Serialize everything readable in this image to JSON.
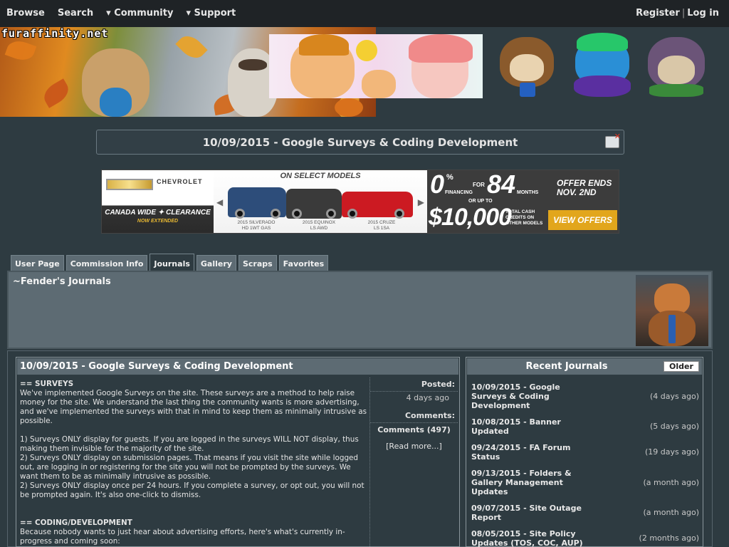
{
  "nav": {
    "left": [
      "Browse",
      "Search",
      "▾ Community",
      "▾ Support"
    ],
    "register": "Register",
    "separator": "|",
    "login": "Log in"
  },
  "banner": {
    "logo_text": "furaffinity.net"
  },
  "journal_title": "10/09/2015 - Google Surveys & Coding Development",
  "ad": {
    "brand": "CHEVROLET",
    "tagline": "CANADA WIDE ✦ CLEARANCE",
    "tagline_sub": "NOW EXTENDED",
    "headline": "ON SELECT MODELS",
    "models": [
      "2015 SILVERADO\nHD 1WT GAS",
      "2015 EQUINOX\nLS AWD",
      "2015 CRUZE\nLS 1SA"
    ],
    "rate": "0",
    "rate_pct": "%",
    "financing": "FINANCING",
    "for": "FOR",
    "months_num": "84",
    "months": "MONTHS",
    "or_up_to": "OR UP TO",
    "cash": "$10,000",
    "cash_note": "TOTAL CASH\nCREDITS ON\nOTHER MODELS",
    "offer_ends": "OFFER ENDS\nNOV. 2ND",
    "cta": "VIEW OFFERS"
  },
  "tabs": [
    "User Page",
    "Commission Info",
    "Journals",
    "Gallery",
    "Scraps",
    "Favorites"
  ],
  "profile": {
    "title": "~Fender's Journals"
  },
  "journal": {
    "header": "10/09/2015 - Google Surveys & Coding Development",
    "body": [
      {
        "t": "== SURVEYS",
        "b": true
      },
      {
        "t": "We've implemented Google Surveys on the site. These surveys are a method to help raise money for the site. We understand the last thing the community wants is more advertising, and we've implemented the surveys with that in mind to keep them as minimally intrusive as possible."
      },
      {
        "t": ""
      },
      {
        "t": "1) Surveys ONLY display for guests. If you are logged in the surveys WILL NOT display, thus making them invisible for the majority of the site."
      },
      {
        "t": "2) Surveys ONLY display on submission pages. That means if you visit the site while logged out, are logging in or registering for the site you will not be prompted by the surveys. We want them to be as minimally intrusive as possible."
      },
      {
        "t": "2) Surveys ONLY display once per 24 hours. If you complete a survey, or opt out, you will not be prompted again. It's also one-click to dismiss."
      },
      {
        "t": ""
      },
      {
        "t": ""
      },
      {
        "t": "== CODING/DEVELOPMENT",
        "b": true
      },
      {
        "t": "Because nobody wants to just hear about advertising efforts, here's what's currently in-progress and coming soon:"
      }
    ],
    "posted_label": "Posted:",
    "posted_value": "4 days ago",
    "comments_label": "Comments:",
    "comments_value": "Comments (497)",
    "read_more": "[Read more...]"
  },
  "recent": {
    "title": "Recent Journals",
    "older": "Older",
    "items": [
      {
        "title": "10/09/2015 - Google Surveys & Coding Development",
        "ago": "(4 days ago)"
      },
      {
        "title": "10/08/2015 - Banner Updated",
        "ago": "(5 days ago)"
      },
      {
        "title": "09/24/2015 - FA Forum Status",
        "ago": "(19 days ago)"
      },
      {
        "title": "09/13/2015 - Folders & Gallery Management Updates",
        "ago": "(a month ago)"
      },
      {
        "title": "09/07/2015 - Site Outage Report",
        "ago": "(a month ago)"
      },
      {
        "title": "08/05/2015 - Site Policy Updates (TOS, COC, AUP)",
        "ago": "(2 months ago)"
      }
    ]
  }
}
